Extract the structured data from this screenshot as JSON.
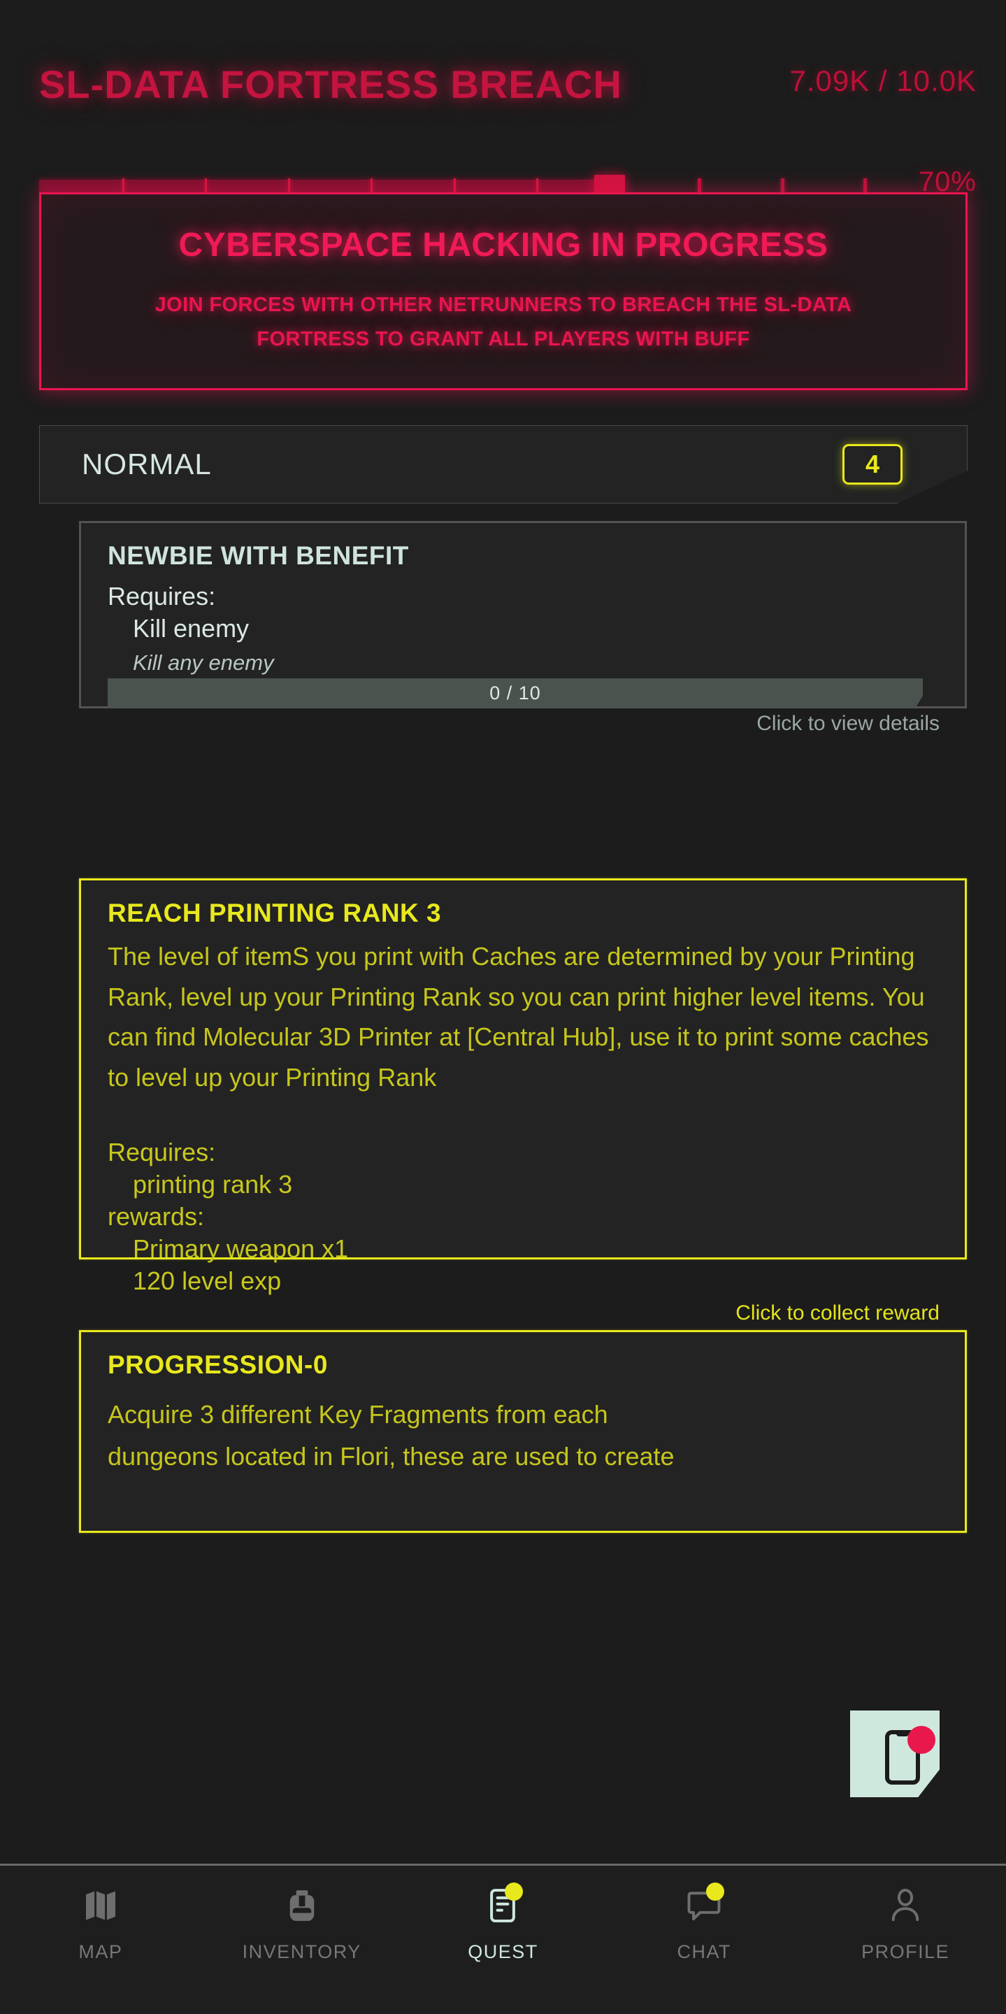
{
  "event": {
    "title": "SL-DATA FORTRESS BREACH",
    "count": "7.09K / 10.0K",
    "percent_label": "70%",
    "percent_value": 70,
    "segments_total": 10,
    "segments_filled": 7,
    "accent_color": "#c4143f"
  },
  "banner": {
    "title": "CYBERSPACE HACKING IN PROGRESS",
    "subtitle_line1": "JOIN FORCES WITH OTHER NETRUNNERS TO BREACH THE SL-DATA",
    "subtitle_line2": "FORTRESS TO GRANT ALL PLAYERS WITH BUFF",
    "border_color": "#ea1551"
  },
  "difficulty": {
    "label": "NORMAL",
    "count": "4",
    "badge_color": "#e8e81e"
  },
  "quests": [
    {
      "title": "NEWBIE WITH BENEFIT",
      "requires_label": "Requires:",
      "requirement": "Kill enemy",
      "requirement_detail": "Kill any enemy",
      "progress_text": "0 / 10",
      "progress_current": 0,
      "progress_total": 10,
      "action": "Click to view details",
      "state": "locked",
      "border_color": "#535353"
    },
    {
      "title": "REACH PRINTING RANK 3",
      "description": "The level of itemS you print with Caches are determined by your Printing Rank, level up your Printing Rank so you can print higher level items. You can find Molecular 3D Printer at [Central Hub], use it to print some caches to level up your Printing Rank",
      "requires_label": "Requires:",
      "requirement": "printing rank 3",
      "rewards_label": "rewards:",
      "rewards": [
        "Primary weapon x1",
        "120 level exp"
      ],
      "action": "Click to collect reward",
      "state": "complete",
      "border_color": "#e8e81e"
    },
    {
      "title": "PROGRESSION-0",
      "description_line1": "Acquire 3 different Key Fragments from each",
      "description_line2": "dungeons located in Flori, these are used to create",
      "state": "active",
      "border_color": "#e8e81e"
    }
  ],
  "note_icon": {
    "name": "phone-notification-icon",
    "background": "#cfe8de",
    "dot_color": "#e8184d"
  },
  "nav": {
    "items": [
      {
        "label": "MAP",
        "icon": "map-icon",
        "active": false,
        "badge": false
      },
      {
        "label": "INVENTORY",
        "icon": "backpack-icon",
        "active": false,
        "badge": false
      },
      {
        "label": "QUEST",
        "icon": "quest-list-icon",
        "active": true,
        "badge": true
      },
      {
        "label": "CHAT",
        "icon": "chat-bubble-icon",
        "active": false,
        "badge": true
      },
      {
        "label": "PROFILE",
        "icon": "person-icon",
        "active": false,
        "badge": false
      }
    ]
  }
}
